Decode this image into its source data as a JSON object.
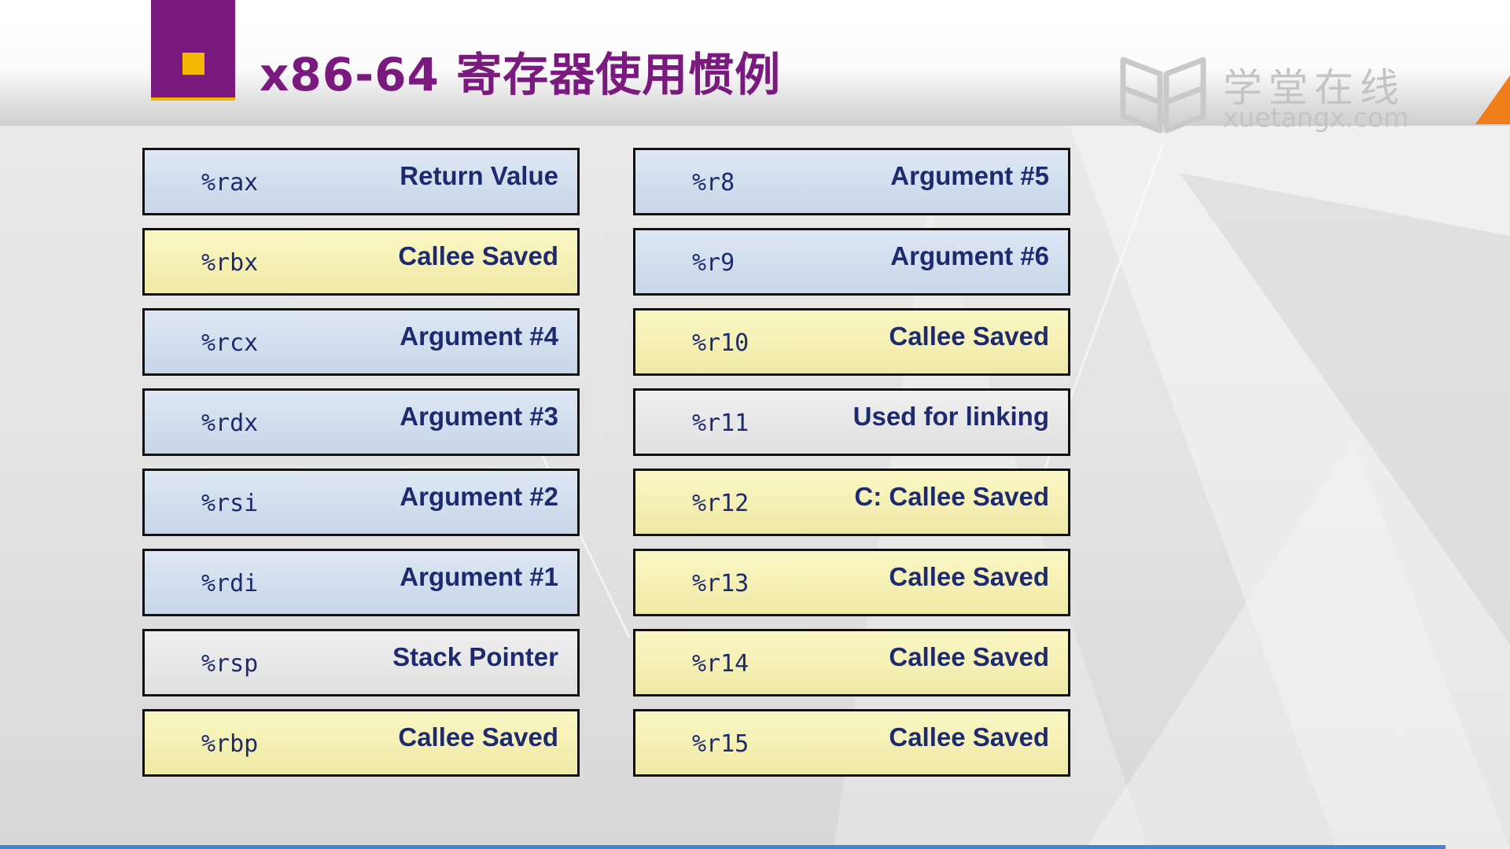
{
  "slide": {
    "title": "x86-64 寄存器使用惯例",
    "logo": {
      "cn": "学堂在线",
      "en": "xuetangx.com",
      "icon": "open-book-icon"
    },
    "colors": {
      "accent_purple": "#7a1a7e",
      "accent_yellow": "#f5b800",
      "text_navy": "#1d2b6e",
      "cell_blue": "#d6e1f0",
      "cell_yellow": "#f6f1b6",
      "cell_gray": "#e8e8e8",
      "logo_orange": "#f07f1a"
    }
  },
  "registers": {
    "left": [
      {
        "name": "%rax",
        "desc": "Return Value",
        "color": "blue"
      },
      {
        "name": "%rbx",
        "desc": "Callee Saved",
        "color": "yellow"
      },
      {
        "name": "%rcx",
        "desc": "Argument #4",
        "color": "blue"
      },
      {
        "name": "%rdx",
        "desc": "Argument #3",
        "color": "blue"
      },
      {
        "name": "%rsi",
        "desc": "Argument #2",
        "color": "blue"
      },
      {
        "name": "%rdi",
        "desc": "Argument #1",
        "color": "blue"
      },
      {
        "name": "%rsp",
        "desc": "Stack Pointer",
        "color": "gray"
      },
      {
        "name": "%rbp",
        "desc": "Callee Saved",
        "color": "yellow"
      }
    ],
    "right": [
      {
        "name": "%r8",
        "desc": "Argument #5",
        "color": "blue"
      },
      {
        "name": "%r9",
        "desc": "Argument #6",
        "color": "blue"
      },
      {
        "name": "%r10",
        "desc": "Callee Saved",
        "color": "yellow"
      },
      {
        "name": "%r11",
        "desc": "Used for linking",
        "color": "gray"
      },
      {
        "name": "%r12",
        "desc": "C: Callee Saved",
        "color": "yellow"
      },
      {
        "name": "%r13",
        "desc": "Callee Saved",
        "color": "yellow"
      },
      {
        "name": "%r14",
        "desc": "Callee Saved",
        "color": "yellow"
      },
      {
        "name": "%r15",
        "desc": "Callee Saved",
        "color": "yellow"
      }
    ]
  }
}
